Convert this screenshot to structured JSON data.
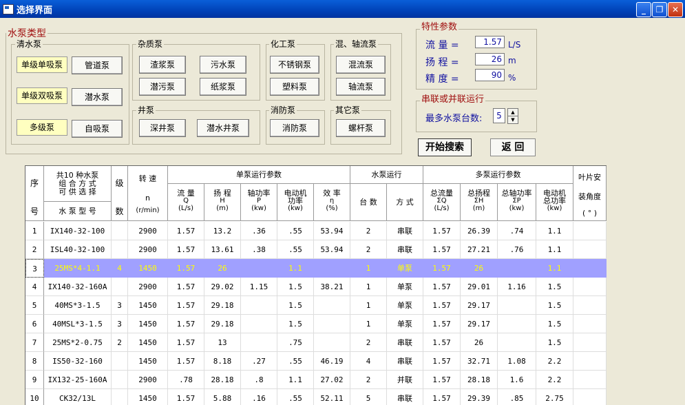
{
  "window": {
    "title": "选择界面"
  },
  "pump_type": {
    "title": "水泵类型",
    "clear": {
      "label": "清水泵",
      "single_suction": "单级单吸泵",
      "double_suction": "单级双吸泵",
      "multistage": "多级泵",
      "pipeline": "管道泵",
      "submersible": "潜水泵",
      "self_priming": "自吸泵"
    },
    "impurity": {
      "label": "杂质泵",
      "slurry": "渣浆泵",
      "sewage": "污水泵",
      "submersible_sewage": "潜污泵",
      "paper_pulp": "纸浆泵"
    },
    "chemical": {
      "label": "化工泵",
      "stainless": "不锈钢泵",
      "plastic": "塑料泵"
    },
    "mixed_axial": {
      "label": "混、轴流泵",
      "mixed": "混流泵",
      "axial": "轴流泵"
    },
    "well": {
      "label": "井泵",
      "deep_well": "深井泵",
      "submersible_well": "潜水井泵"
    },
    "fire": {
      "label": "消防泵",
      "fire_pump": "消防泵"
    },
    "other": {
      "label": "其它泵",
      "screw": "螺杆泵"
    }
  },
  "params": {
    "title": "特性参数",
    "flow_label": "流  量 =",
    "flow_value": "1.57",
    "flow_unit": "L/S",
    "head_label": "扬  程 =",
    "head_value": "26",
    "head_unit": "m",
    "precision_label": "精  度 =",
    "precision_value": "90",
    "precision_unit": "%"
  },
  "series": {
    "title": "串联或并联运行",
    "max_label": "最多水泵台数:",
    "max_value": "5"
  },
  "actions": {
    "search": "开始搜索",
    "back": "返  回"
  },
  "table": {
    "h_seq": "序",
    "h_seq2": "号",
    "h_combo": "共10 种水泵\n组 合 方 式\n可 供 选 择",
    "h_model": "水 泵 型 号",
    "h_stage": "级",
    "h_stage2": "数",
    "h_speed": "转  速",
    "h_speed_n": "n",
    "h_speed_unit": "(r/min)",
    "h_single": "单泵运行参数",
    "h_flow": "流  量",
    "h_flow_s": "Q",
    "h_flow_u": "(L/s)",
    "h_head": "扬  程",
    "h_head_s": "H",
    "h_head_u": "(m)",
    "h_shaft": "轴功率",
    "h_shaft_s": "P",
    "h_shaft_u": "(kw)",
    "h_motor": "电动机",
    "h_motor_2": "功率",
    "h_motor_u": "(kw)",
    "h_eff": "效  率",
    "h_eff_s": "η",
    "h_eff_u": "(%)",
    "h_op": "水泵运行",
    "h_count": "台  数",
    "h_mode": "方  式",
    "h_multi": "多泵运行参数",
    "h_tflow": "总流量",
    "h_tflow_s": "ΣQ",
    "h_tflow_u": "(L/s)",
    "h_thead": "总扬程",
    "h_thead_s": "ΣH",
    "h_thead_u": "(m)",
    "h_tshaft": "总轴功率",
    "h_tshaft_s": "ΣP",
    "h_tshaft_u": "(kw)",
    "h_tmotor": "电动机",
    "h_tmotor_2": "总功率",
    "h_tmotor_u": "(kw)",
    "h_blade": "叶片安",
    "h_blade2": "装角度",
    "h_blade3": "(  °  )",
    "rows": [
      {
        "seq": "1",
        "model": "IX140-32-100",
        "stage": "",
        "speed": "2900",
        "q": "1.57",
        "h": "13.2",
        "p": ".36",
        "m": ".55",
        "e": "53.94",
        "n": "2",
        "mode": "串联",
        "tq": "1.57",
        "th": "26.39",
        "tp": ".74",
        "tm": "1.1",
        "angle": ""
      },
      {
        "seq": "2",
        "model": "ISL40-32-100",
        "stage": "",
        "speed": "2900",
        "q": "1.57",
        "h": "13.61",
        "p": ".38",
        "m": ".55",
        "e": "53.94",
        "n": "2",
        "mode": "串联",
        "tq": "1.57",
        "th": "27.21",
        "tp": ".76",
        "tm": "1.1",
        "angle": ""
      },
      {
        "seq": "3",
        "model": "25MS*4-1.1",
        "stage": "4",
        "speed": "1450",
        "q": "1.57",
        "h": "26",
        "p": "",
        "m": "1.1",
        "e": "",
        "n": "1",
        "mode": "单泵",
        "tq": "1.57",
        "th": "26",
        "tp": "",
        "tm": "1.1",
        "angle": ""
      },
      {
        "seq": "4",
        "model": "IX140-32-160A",
        "stage": "",
        "speed": "2900",
        "q": "1.57",
        "h": "29.02",
        "p": "1.15",
        "m": "1.5",
        "e": "38.21",
        "n": "1",
        "mode": "单泵",
        "tq": "1.57",
        "th": "29.01",
        "tp": "1.16",
        "tm": "1.5",
        "angle": ""
      },
      {
        "seq": "5",
        "model": "40MS*3-1.5",
        "stage": "3",
        "speed": "1450",
        "q": "1.57",
        "h": "29.18",
        "p": "",
        "m": "1.5",
        "e": "",
        "n": "1",
        "mode": "单泵",
        "tq": "1.57",
        "th": "29.17",
        "tp": "",
        "tm": "1.5",
        "angle": ""
      },
      {
        "seq": "6",
        "model": "40MSL*3-1.5",
        "stage": "3",
        "speed": "1450",
        "q": "1.57",
        "h": "29.18",
        "p": "",
        "m": "1.5",
        "e": "",
        "n": "1",
        "mode": "单泵",
        "tq": "1.57",
        "th": "29.17",
        "tp": "",
        "tm": "1.5",
        "angle": ""
      },
      {
        "seq": "7",
        "model": "25MS*2-0.75",
        "stage": "2",
        "speed": "1450",
        "q": "1.57",
        "h": "13",
        "p": "",
        "m": ".75",
        "e": "",
        "n": "2",
        "mode": "串联",
        "tq": "1.57",
        "th": "26",
        "tp": "",
        "tm": "1.5",
        "angle": ""
      },
      {
        "seq": "8",
        "model": "IS50-32-160",
        "stage": "",
        "speed": "1450",
        "q": "1.57",
        "h": "8.18",
        "p": ".27",
        "m": ".55",
        "e": "46.19",
        "n": "4",
        "mode": "串联",
        "tq": "1.57",
        "th": "32.71",
        "tp": "1.08",
        "tm": "2.2",
        "angle": ""
      },
      {
        "seq": "9",
        "model": "IX132-25-160A",
        "stage": "",
        "speed": "2900",
        "q": ".78",
        "h": "28.18",
        "p": ".8",
        "m": "1.1",
        "e": "27.02",
        "n": "2",
        "mode": "并联",
        "tq": "1.57",
        "th": "28.18",
        "tp": "1.6",
        "tm": "2.2",
        "angle": ""
      },
      {
        "seq": "10",
        "model": "CK32/13L",
        "stage": "",
        "speed": "1450",
        "q": "1.57",
        "h": "5.88",
        "p": ".16",
        "m": ".55",
        "e": "52.11",
        "n": "5",
        "mode": "串联",
        "tq": "1.57",
        "th": "29.39",
        "tp": ".85",
        "tm": "2.75",
        "angle": ""
      }
    ],
    "selected_row": 2
  }
}
